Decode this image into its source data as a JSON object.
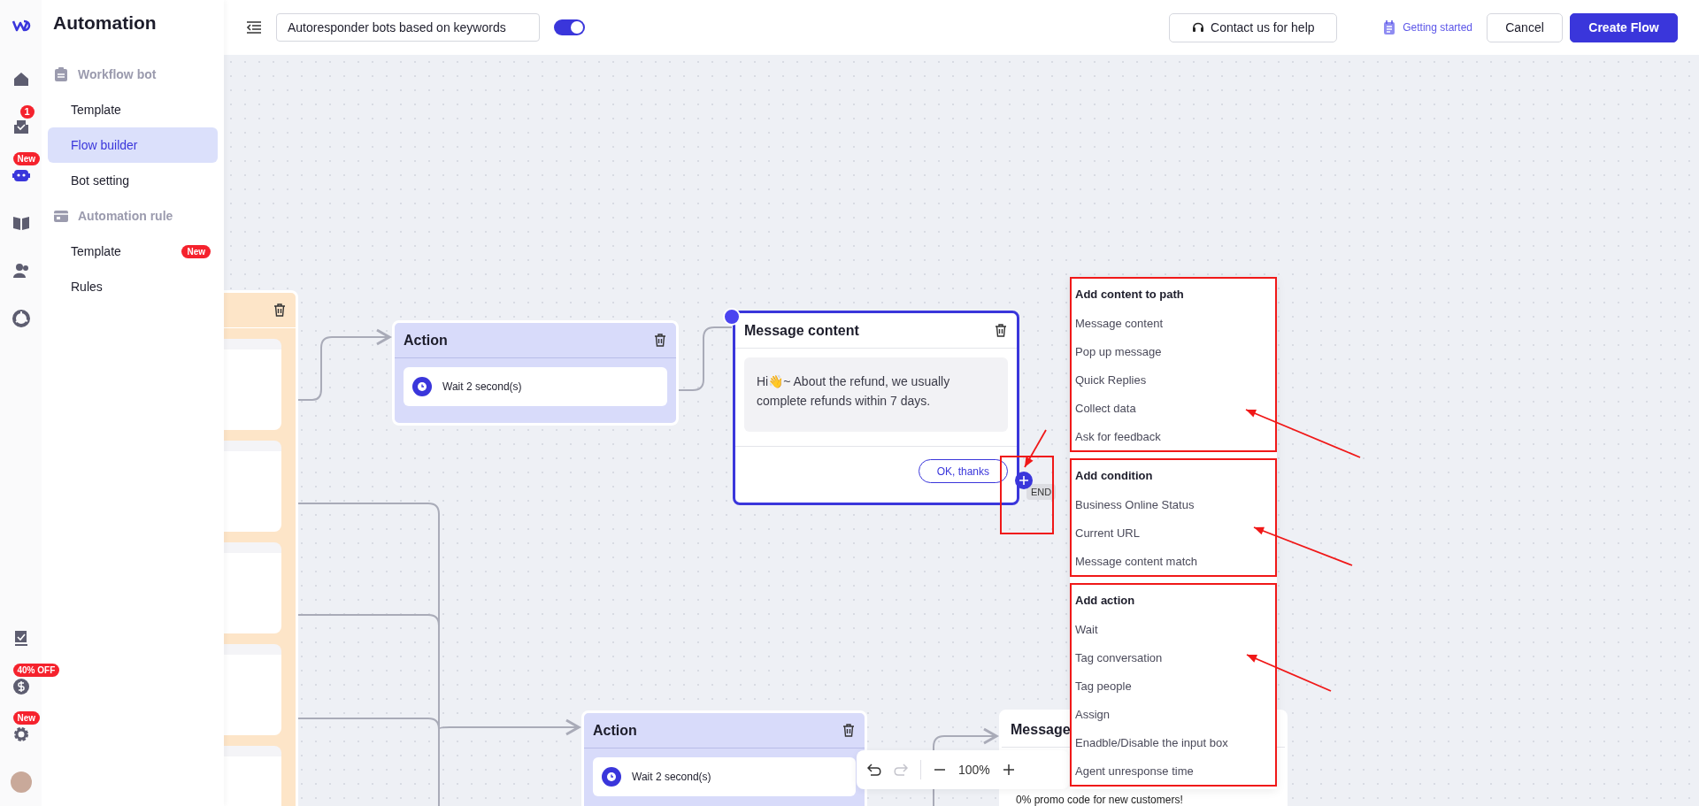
{
  "rail": {
    "logo": {
      "kind": "logo"
    },
    "items": [
      {
        "kind": "home",
        "selected": false
      },
      {
        "kind": "inbox",
        "selected": false,
        "badge": "1"
      },
      {
        "kind": "bot",
        "selected": true,
        "badge": "New"
      },
      {
        "kind": "book",
        "selected": false
      },
      {
        "kind": "people",
        "selected": false
      },
      {
        "kind": "chart",
        "selected": false
      }
    ],
    "bottom_items": [
      {
        "kind": "tasks",
        "selected": false
      },
      {
        "kind": "billing",
        "selected": false,
        "badge": "40% OFF"
      },
      {
        "kind": "settings",
        "selected": false,
        "badge": "New"
      },
      {
        "kind": "avatar"
      }
    ]
  },
  "sidebar": {
    "title": "Automation",
    "groups": [
      {
        "kind": "clipboard",
        "label": "Workflow bot",
        "items": [
          {
            "label": "Template",
            "selected": false
          },
          {
            "label": "Flow builder",
            "selected": true
          },
          {
            "label": "Bot setting",
            "selected": false
          }
        ]
      },
      {
        "kind": "card",
        "label": "Automation rule",
        "items": [
          {
            "label": "Template",
            "selected": false,
            "badge": "New"
          },
          {
            "label": "Rules",
            "selected": false
          }
        ]
      }
    ]
  },
  "topbar": {
    "flow_name": "Autoresponder bots based on keywords",
    "enabled": {
      "on": true
    },
    "help_button": "Contact us for help",
    "guide_link": "Getting started",
    "cancel_button": "Cancel",
    "create_button": "Create Flow"
  },
  "canvas": {
    "nodes": [
      {
        "kind": "trigger",
        "selected": false
      },
      {
        "kind": "action",
        "title": "Action",
        "step": "Wait 2 second(s)",
        "selected": false
      },
      {
        "kind": "message",
        "title": "Message content",
        "text": "Hi👋~ About the refund, we usually complete refunds within 7 days.",
        "button": "OK, thanks",
        "selected": true,
        "end_label": "END"
      },
      {
        "kind": "action",
        "title": "Action",
        "step": "Wait 2 second(s)",
        "selected": false
      },
      {
        "kind": "message",
        "title": "Message",
        "text": "0% promo code for new customers!",
        "selected": false
      }
    ],
    "add_menu": {
      "sections": [
        {
          "heading": "Add content to path",
          "items": [
            "Message content",
            "Pop up message",
            "Quick Replies",
            "Collect data",
            "Ask for feedback"
          ]
        },
        {
          "heading": "Add condition",
          "items": [
            "Business Online Status",
            "Current URL",
            "Message content match"
          ]
        },
        {
          "heading": "Add action",
          "items": [
            "Wait",
            "Tag conversation",
            "Tag people",
            "Assign",
            "Enadble/Disable the input box",
            "Agent unresponse time"
          ]
        }
      ]
    },
    "zoom": {
      "value": "100%"
    }
  }
}
